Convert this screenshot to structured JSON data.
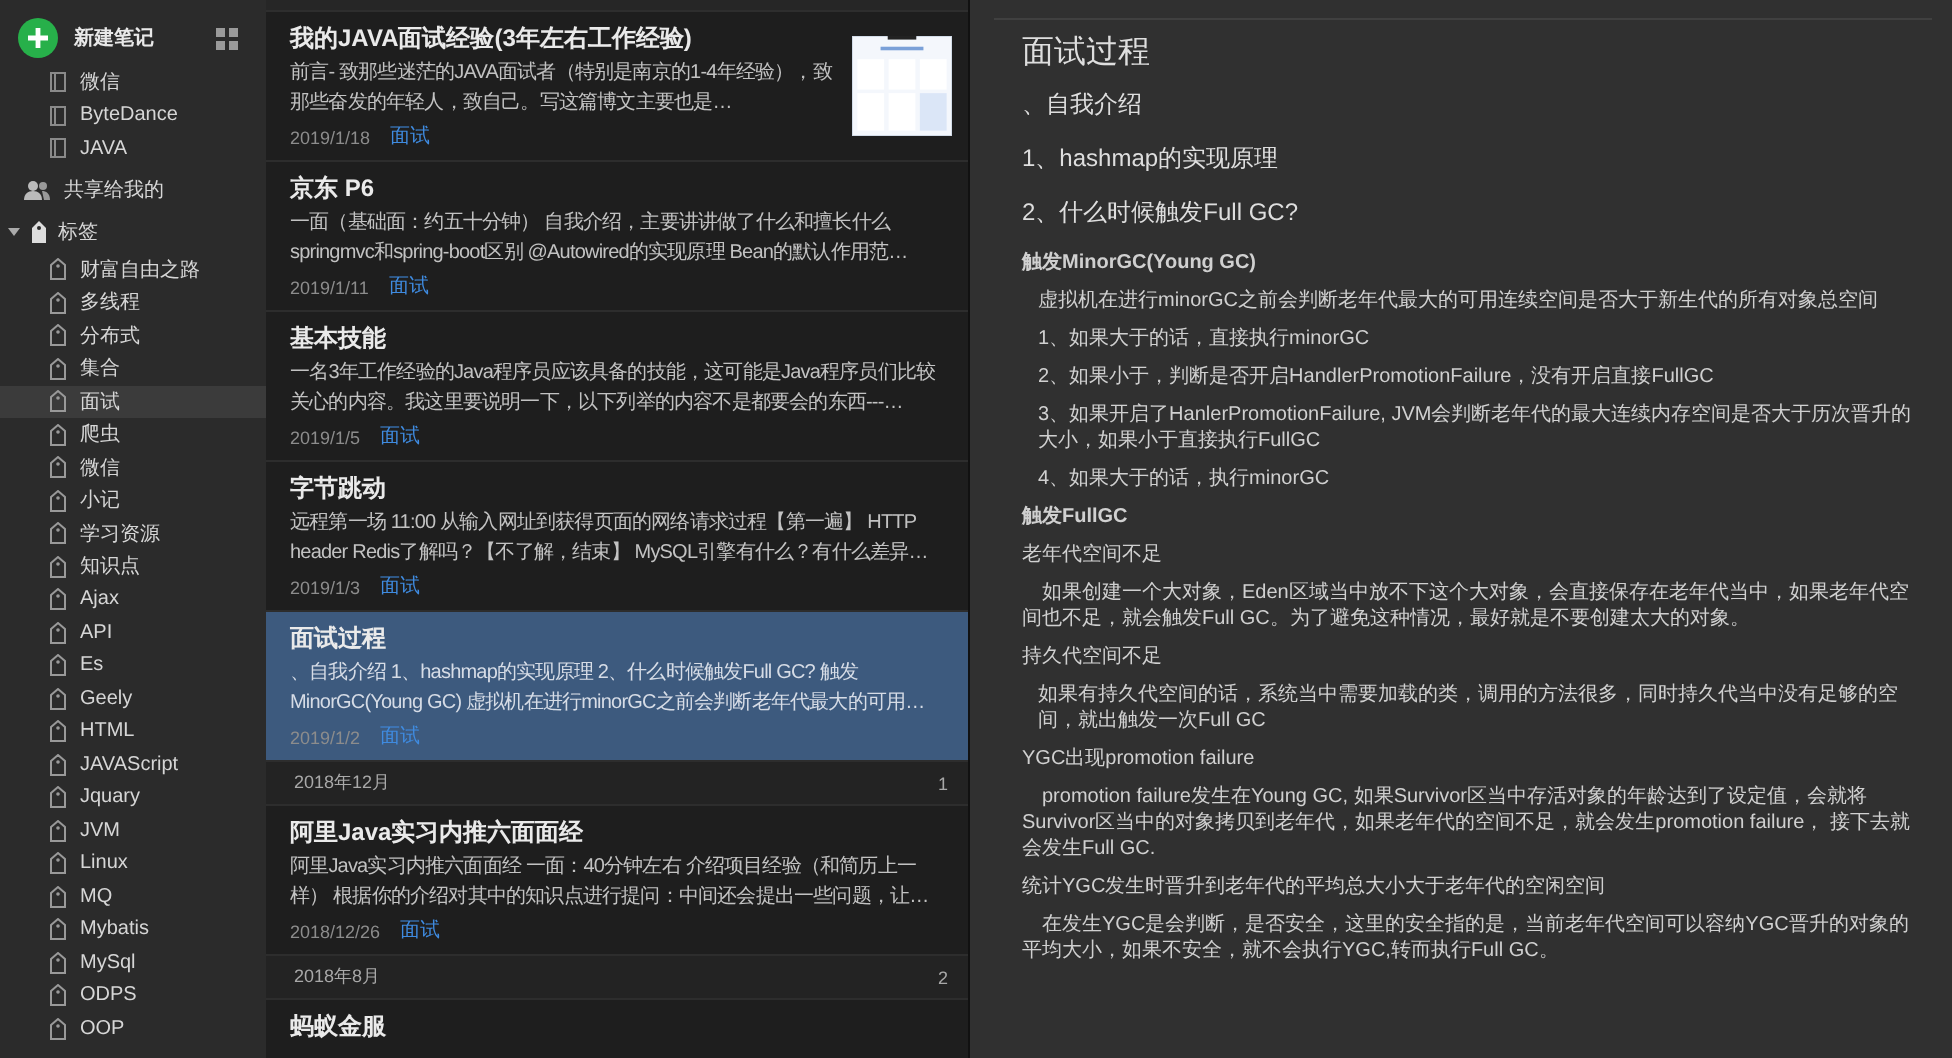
{
  "sidebar": {
    "new_note_button": "新建笔记",
    "notebooks": [
      {
        "label": "微信"
      },
      {
        "label": "ByteDance"
      },
      {
        "label": "JAVA"
      }
    ],
    "shared": {
      "label": "共享给我的"
    },
    "tags": {
      "label": "标签",
      "expanded": true,
      "children": [
        {
          "label": "财富自由之路",
          "selected": false
        },
        {
          "label": "多线程",
          "selected": false
        },
        {
          "label": "分布式",
          "selected": false
        },
        {
          "label": "集合",
          "selected": false
        },
        {
          "label": "面试",
          "selected": true
        },
        {
          "label": "爬虫",
          "selected": false
        },
        {
          "label": "微信",
          "selected": false
        },
        {
          "label": "小记",
          "selected": false
        },
        {
          "label": "学习资源",
          "selected": false
        },
        {
          "label": "知识点",
          "selected": false
        },
        {
          "label": "Ajax",
          "selected": false
        },
        {
          "label": "API",
          "selected": false
        },
        {
          "label": "Es",
          "selected": false
        },
        {
          "label": "Geely",
          "selected": false
        },
        {
          "label": "HTML",
          "selected": false
        },
        {
          "label": "JAVAScript",
          "selected": false
        },
        {
          "label": "Jquary",
          "selected": false
        },
        {
          "label": "JVM",
          "selected": false
        },
        {
          "label": "Linux",
          "selected": false
        },
        {
          "label": "MQ",
          "selected": false
        },
        {
          "label": "Mybatis",
          "selected": false
        },
        {
          "label": "MySql",
          "selected": false
        },
        {
          "label": "ODPS",
          "selected": false
        },
        {
          "label": "OOP",
          "selected": false
        }
      ]
    }
  },
  "note_list": [
    {
      "kind": "note",
      "title": "我的JAVA面试经验(3年左右工作经验)",
      "snippet": "前言- 致那些迷茫的JAVA面试者（特别是南京的1-4年经验），致那些奋发的年轻人，致自己。写这篇博文主要也是…",
      "date": "2019/1/18",
      "tag": "面试",
      "thumbnail": true,
      "selected": false
    },
    {
      "kind": "note",
      "title": "京东 P6",
      "snippet": "一面（基础面：约五十分钟） 自我介绍，主要讲讲做了什么和擅长什么 springmvc和spring-boot区别 @Autowired的实现原理 Bean的默认作用范…",
      "date": "2019/1/11",
      "tag": "面试",
      "thumbnail": false,
      "selected": false
    },
    {
      "kind": "note",
      "title": "基本技能",
      "snippet": "一名3年工作经验的Java程序员应该具备的技能，这可能是Java程序员们比较关心的内容。我这里要说明一下，以下列举的内容不是都要会的东西---…",
      "date": "2019/1/5",
      "tag": "面试",
      "thumbnail": false,
      "selected": false
    },
    {
      "kind": "note",
      "title": "字节跳动",
      "snippet": "远程第一场 11:00 从输入网址到获得页面的网络请求过程【第一遍】 HTTP header Redis了解吗？【不了解，结束】 MySQL引擎有什么？有什么差异…",
      "date": "2019/1/3",
      "tag": "面试",
      "thumbnail": false,
      "selected": false
    },
    {
      "kind": "note",
      "title": "面试过程",
      "snippet": "、自我介绍 1、hashmap的实现原理 2、什么时候触发Full GC? 触发MinorGC(Young GC) 虚拟机在进行minorGC之前会判断老年代最大的可用…",
      "date": "2019/1/2",
      "tag": "面试",
      "thumbnail": false,
      "selected": true
    },
    {
      "kind": "group",
      "label": "2018年12月",
      "count": "1"
    },
    {
      "kind": "note",
      "title": "阿里Java实习内推六面面经",
      "snippet": "阿里Java实习内推六面面经 一面：40分钟左右 介绍项目经验（和简历上一样） 根据你的介绍对其中的知识点进行提问：中间还会提出一些问题，让…",
      "date": "2018/12/26",
      "tag": "面试",
      "thumbnail": false,
      "selected": false
    },
    {
      "kind": "group",
      "label": "2018年8月",
      "count": "2"
    },
    {
      "kind": "note",
      "title": "蚂蚁金服",
      "selected": false
    }
  ],
  "editor": {
    "title": "面试过程",
    "blocks": [
      {
        "kind": "heading",
        "text": "、自我介绍"
      },
      {
        "kind": "heading",
        "text": "1、hashmap的实现原理"
      },
      {
        "kind": "heading",
        "text": "2、什么时候触发Full GC?"
      },
      {
        "kind": "bold",
        "text": "触发MinorGC(Young GC)"
      },
      {
        "kind": "indent",
        "text": "虚拟机在进行minorGC之前会判断老年代最大的可用连续空间是否大于新生代的所有对象总空间"
      },
      {
        "kind": "indent",
        "text": "1、如果大于的话，直接执行minorGC"
      },
      {
        "kind": "indent",
        "text": "2、如果小于，判断是否开启HandlerPromotionFailure，没有开启直接FullGC"
      },
      {
        "kind": "indent",
        "text": "3、如果开启了HanlerPromotionFailure, JVM会判断老年代的最大连续内存空间是否大于历次晋升的大小，如果小于直接执行FullGC"
      },
      {
        "kind": "indent",
        "text": "4、如果大于的话，执行minorGC"
      },
      {
        "kind": "bold",
        "text": "触发FullGC"
      },
      {
        "kind": "plain",
        "text": "老年代空间不足"
      },
      {
        "kind": "para",
        "text": "如果创建一个大对象，Eden区域当中放不下这个大对象，会直接保存在老年代当中，如果老年代空间也不足，就会触发Full GC。为了避免这种情况，最好就是不要创建太大的对象。"
      },
      {
        "kind": "plain",
        "text": "持久代空间不足"
      },
      {
        "kind": "indent",
        "text": "如果有持久代空间的话，系统当中需要加载的类，调用的方法很多，同时持久代当中没有足够的空间，就出触发一次Full GC"
      },
      {
        "kind": "plain",
        "text": "YGC出现promotion failure"
      },
      {
        "kind": "para",
        "text": "promotion failure发生在Young GC, 如果Survivor区当中存活对象的年龄达到了设定值，会就将Survivor区当中的对象拷贝到老年代，如果老年代的空间不足，就会发生promotion failure， 接下去就会发生Full GC."
      },
      {
        "kind": "plain",
        "text": "统计YGC发生时晋升到老年代的平均总大小大于老年代的空闲空间"
      },
      {
        "kind": "para",
        "text": "在发生YGC是会判断，是否安全，这里的安全指的是，当前老年代空间可以容纳YGC晋升的对象的平均大小，如果不安全，就不会执行YGC,转而执行Full GC。"
      }
    ]
  }
}
